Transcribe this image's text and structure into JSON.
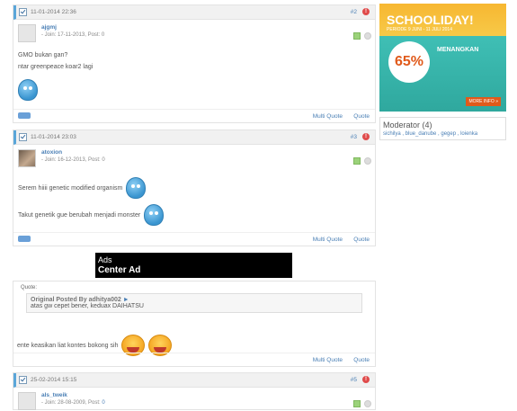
{
  "posts": [
    {
      "timestamp": "11-01-2014 22:36",
      "number": "#2",
      "username": "ajgmj",
      "join_info": "- Join: 17-11-2013, Post: 0",
      "lines": [
        "GMO bukan gan?",
        "ntar greenpeace koar2 lagi"
      ]
    },
    {
      "timestamp": "11-01-2014 23:03",
      "number": "#3",
      "username": "atoxion",
      "join_info": "- Join: 16-12-2013, Post: 0",
      "lines": [
        "Serem hiiii genetic modified organism",
        "Takut genetik gue berubah menjadi monster"
      ]
    },
    {
      "timestamp": "25-02-2014 15:15",
      "number": "#5",
      "username": "als_tweik",
      "join_info_prefix": "- Join: 28-08-2009, Post:",
      "join_info_post": "0"
    }
  ],
  "actions": {
    "multi_quote": "Multi Quote",
    "quote": "Quote"
  },
  "ad": {
    "line1": "Ads",
    "line2": "Center Ad"
  },
  "quote_block": {
    "label": "Quote:",
    "original_posted_by": "Original Posted By",
    "author": "adhitya002",
    "text": "atas gw cepet bener, keduax DAIHATSU",
    "reply": "ente keasikan liat kontes bokong sih"
  },
  "sidebar": {
    "banner": {
      "title": "SCHOOLIDAY!",
      "dates": "PERIODE 9 JUNI - 11 JULI 2014",
      "discount": "65%",
      "win": "MENANGKAN",
      "more": "MORE INFO »"
    },
    "moderator_title": "Moderator (4)",
    "moderators": "sichilya , blue_danube , gegep , loienka"
  },
  "colors": {
    "accent": "#4a7fb5",
    "header_border": "#5aa6d9",
    "rep_icon": "#e04b4b"
  }
}
